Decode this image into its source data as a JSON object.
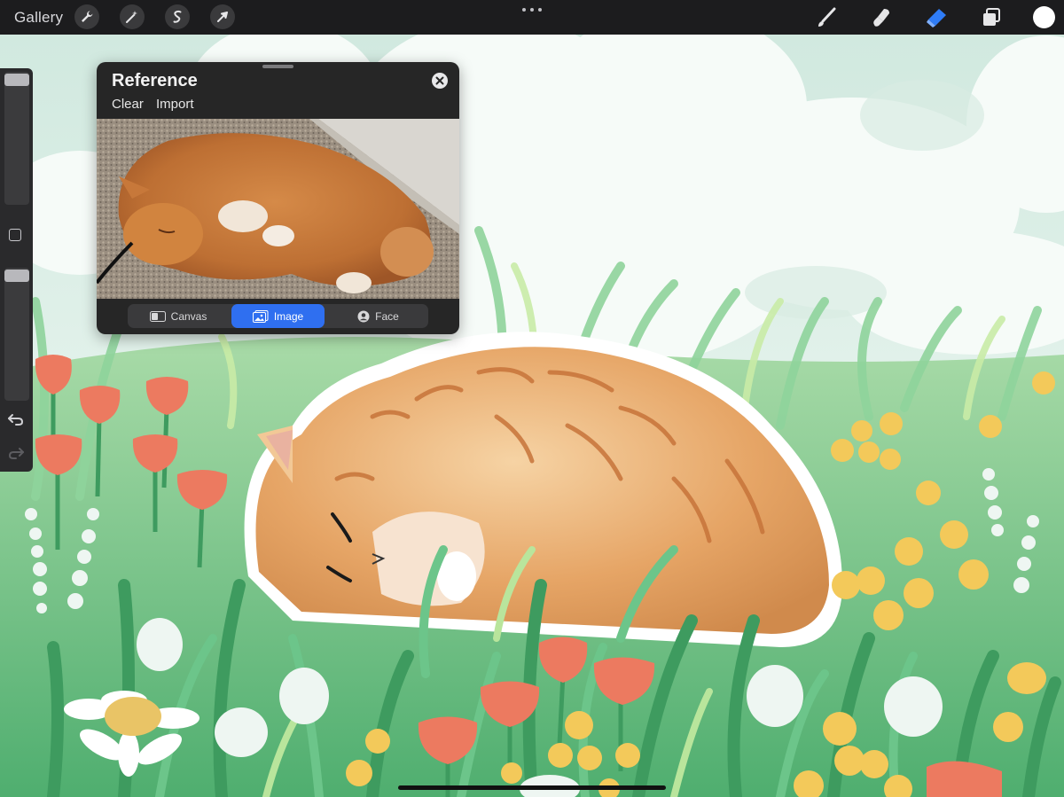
{
  "toolbar": {
    "gallery_label": "Gallery",
    "left_tools": [
      "wrench-icon",
      "magic-wand-icon",
      "selection-icon",
      "transform-arrow-icon"
    ],
    "right_tools": [
      "brush-icon",
      "smudge-icon",
      "eraser-icon",
      "layers-icon"
    ],
    "active_tool": "eraser",
    "accent_color": "#2f7cf6",
    "current_color": "#ffffff"
  },
  "sidebar": {
    "brush_size_level": 0.05,
    "opacity_level": 0.05
  },
  "reference_panel": {
    "title": "Reference",
    "actions": {
      "clear_label": "Clear",
      "import_label": "Import"
    },
    "segments": [
      {
        "label": "Canvas",
        "icon": "canvas-icon"
      },
      {
        "label": "Image",
        "icon": "image-icon"
      },
      {
        "label": "Face",
        "icon": "face-icon"
      }
    ],
    "active_segment": "Image",
    "active_color": "#2f6ff0"
  },
  "colors": {
    "toolbar_bg": "#1c1c1e",
    "panel_bg": "#262626",
    "cat_orange": "#e8a35c",
    "grass_green": "#5fbf7a",
    "tulip_coral": "#ec7a60",
    "flower_yellow": "#f3c95a",
    "cloud_white": "#f4faf7"
  }
}
